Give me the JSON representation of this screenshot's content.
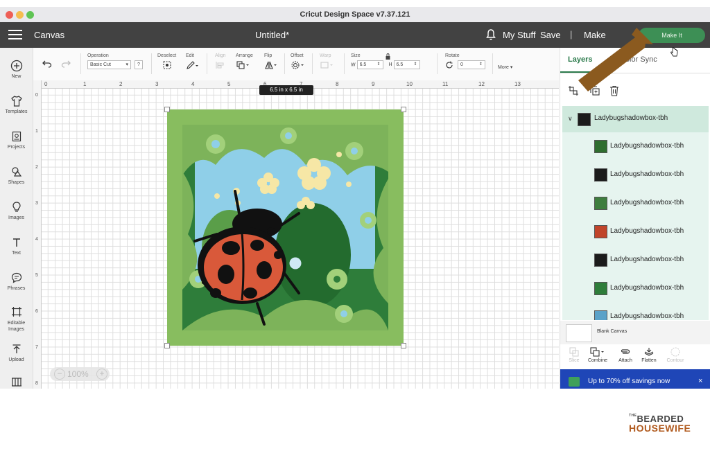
{
  "window": {
    "title": "Cricut Design Space  v7.37.121"
  },
  "header": {
    "canvas_label": "Canvas",
    "doc_title": "Untitled*",
    "my_stuff": "My Stuff",
    "save": "Save",
    "separator": "|",
    "make": "Make",
    "make_it": "Make It"
  },
  "sidebar": {
    "items": [
      {
        "label": "New",
        "icon": "plus-circle-icon"
      },
      {
        "label": "Templates",
        "icon": "shirt-icon"
      },
      {
        "label": "Projects",
        "icon": "projects-icon"
      },
      {
        "label": "Shapes",
        "icon": "shapes-icon"
      },
      {
        "label": "Images",
        "icon": "lightbulb-icon"
      },
      {
        "label": "Text",
        "icon": "text-icon"
      },
      {
        "label": "Phrases",
        "icon": "speech-bubble-icon"
      },
      {
        "label": "Editable Images",
        "icon": "editable-images-icon"
      },
      {
        "label": "Upload",
        "icon": "upload-icon"
      },
      {
        "label": "",
        "icon": "monogram-icon"
      }
    ]
  },
  "toolbar": {
    "operation_label": "Operation",
    "operation_value": "Basic Cut",
    "help": "?",
    "deselect": "Deselect",
    "edit": "Edit",
    "align": "Align",
    "arrange": "Arrange",
    "flip": "Flip",
    "offset": "Offset",
    "warp": "Warp",
    "size": "Size",
    "w_label": "W",
    "w_value": "6.5",
    "h_label": "H",
    "h_value": "6.5",
    "rotate": "Rotate",
    "rotate_value": "0",
    "more": "More ▾"
  },
  "canvas": {
    "ruler_h": [
      "0",
      "1",
      "2",
      "3",
      "4",
      "5",
      "6",
      "7",
      "8",
      "9",
      "10",
      "11",
      "12",
      "13"
    ],
    "ruler_v": [
      "0",
      "1",
      "2",
      "3",
      "4",
      "5",
      "6",
      "7",
      "8"
    ],
    "size_tooltip": "6.5  in x 6.5  in",
    "zoom": "100%",
    "zoom_out": "−",
    "zoom_in": "+"
  },
  "right_panel": {
    "tab_layers": "Layers",
    "tab_color": "Color Sync",
    "group_name": "Ladybugshadowbox-tbh",
    "layers": [
      {
        "name": "Ladybugshadowbox-tbh",
        "thumb_color": "#2f6d2f"
      },
      {
        "name": "Ladybugshadowbox-tbh",
        "thumb_color": "#1b1b1b"
      },
      {
        "name": "Ladybugshadowbox-tbh",
        "thumb_color": "#3e7d3e"
      },
      {
        "name": "Ladybugshadowbox-tbh",
        "thumb_color": "#c0442a"
      },
      {
        "name": "Ladybugshadowbox-tbh",
        "thumb_color": "#1b1b1b"
      },
      {
        "name": "Ladybugshadowbox-tbh",
        "thumb_color": "#2e7d3a"
      },
      {
        "name": "Ladybugshadowbox-tbh",
        "thumb_color": "#5aa2c8"
      }
    ],
    "blank_canvas": "Blank Canvas",
    "bottom_tools": [
      {
        "label": "Slice",
        "enabled": false
      },
      {
        "label": "Combine",
        "enabled": true
      },
      {
        "label": "Attach",
        "enabled": true
      },
      {
        "label": "Flatten",
        "enabled": true
      },
      {
        "label": "Contour",
        "enabled": false
      }
    ],
    "banner_text": "Up to 70% off savings now",
    "banner_close": "×"
  },
  "watermark": {
    "line_the": "THE",
    "line1": "BEARDED",
    "line2": "HOUSEWIFE"
  },
  "colors": {
    "header_bg": "#424242",
    "accent_green": "#3d8f55",
    "arrow_brown": "#8b5a1f",
    "banner_blue": "#1f46b7",
    "layer_selected": "#cfe9dd"
  }
}
